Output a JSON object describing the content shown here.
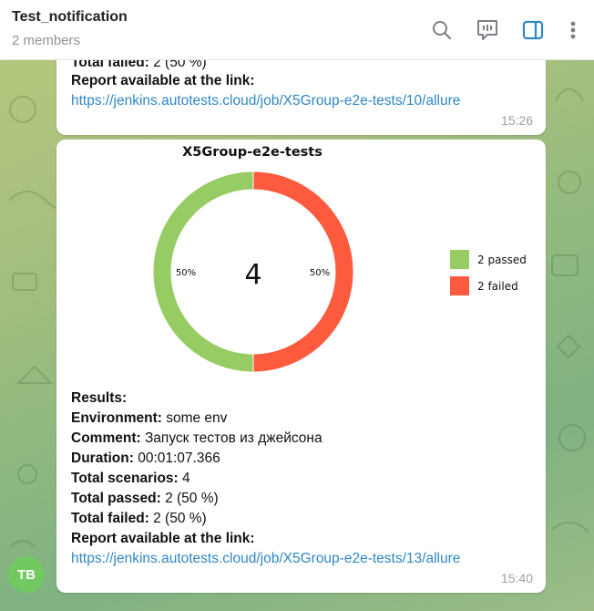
{
  "header": {
    "title": "Test_notification",
    "subtitle": "2 members"
  },
  "messages": [
    {
      "failed_label": "Total failed:",
      "failed_value": " 2 (50 %)",
      "report_label": "Report available at the link:",
      "link": "https://jenkins.autotests.cloud/job/X5Group-e2e-tests/10/allure",
      "time": "15:26"
    },
    {
      "results_label": "Results:",
      "env_label": "Environment:",
      "env_value": " some env",
      "comment_label": "Comment:",
      "comment_value": " Запуск тестов из джейсона",
      "duration_label": "Duration:",
      "duration_value": " 00:01:07.366",
      "scenarios_label": "Total scenarios:",
      "scenarios_value": " 4",
      "passed_label": "Total passed:",
      "passed_value": " 2 (50 %)",
      "failed_label": "Total failed:",
      "failed_value": " 2 (50 %)",
      "report_label": "Report available at the link:",
      "link": "https://jenkins.autotests.cloud/job/X5Group-e2e-tests/13/allure",
      "time": "15:40"
    }
  ],
  "avatar": {
    "initials": "TB",
    "color": "#72c95f"
  },
  "chart_data": {
    "type": "pie",
    "title": "X5Group-e2e-tests",
    "center_label": "4",
    "series": [
      {
        "name": "passed",
        "legend": "2 passed",
        "value": 2,
        "percent_label": "50%",
        "color": "#97cc64"
      },
      {
        "name": "failed",
        "legend": "2 failed",
        "value": 2,
        "percent_label": "50%",
        "color": "#fd5a3e"
      }
    ],
    "legend_position": "right"
  },
  "icons": [
    "search-icon",
    "topic-icon",
    "sidebar-toggle-icon",
    "more-icon"
  ]
}
